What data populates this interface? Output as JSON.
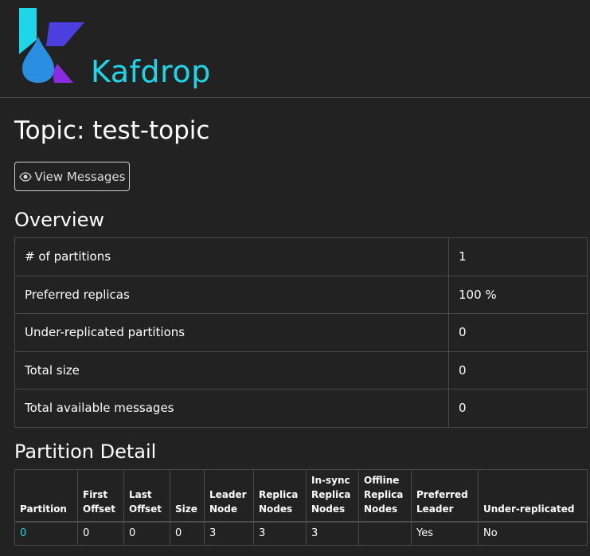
{
  "brand": {
    "name": "Kafdrop"
  },
  "page": {
    "title": "Topic: test-topic"
  },
  "actions": {
    "view_messages": "View Messages"
  },
  "overview": {
    "title": "Overview",
    "rows": [
      {
        "label": "# of partitions",
        "value": "1"
      },
      {
        "label": "Preferred replicas",
        "value": "100 %"
      },
      {
        "label": "Under-replicated partitions",
        "value": "0"
      },
      {
        "label": "Total size",
        "value": "0"
      },
      {
        "label": "Total available messages",
        "value": "0"
      }
    ]
  },
  "partition_detail": {
    "title": "Partition Detail",
    "headers": {
      "partition": "Partition",
      "first_offset_1": "First",
      "first_offset_2": "Offset",
      "last_offset_1": "Last",
      "last_offset_2": "Offset",
      "size": "Size",
      "leader_node_1": "Leader",
      "leader_node_2": "Node",
      "replica_nodes_1": "Replica",
      "replica_nodes_2": "Nodes",
      "insync_1": "In-sync",
      "insync_2": "Replica",
      "insync_3": "Nodes",
      "offline_1": "Offline",
      "offline_2": "Replica",
      "offline_3": "Nodes",
      "preferred_1": "Preferred",
      "preferred_2": "Leader",
      "under_replicated": "Under-replicated"
    },
    "rows": [
      {
        "partition": "0",
        "first_offset": "0",
        "last_offset": "0",
        "size": "0",
        "leader_node": "3",
        "replica_nodes": "3",
        "insync_replica_nodes": "3",
        "offline_replica_nodes": "",
        "preferred_leader": "Yes",
        "under_replicated": "No"
      }
    ]
  },
  "colors": {
    "background": "#222222",
    "accent": "#1fd6e8",
    "logo_blue": "#2a8fe0",
    "logo_purple": "#8a2be2",
    "logo_indigo": "#4b3fe0",
    "border": "#4a4a4a"
  },
  "icons": {
    "logo": "kafdrop-logo-icon",
    "eye": "eye-icon"
  }
}
